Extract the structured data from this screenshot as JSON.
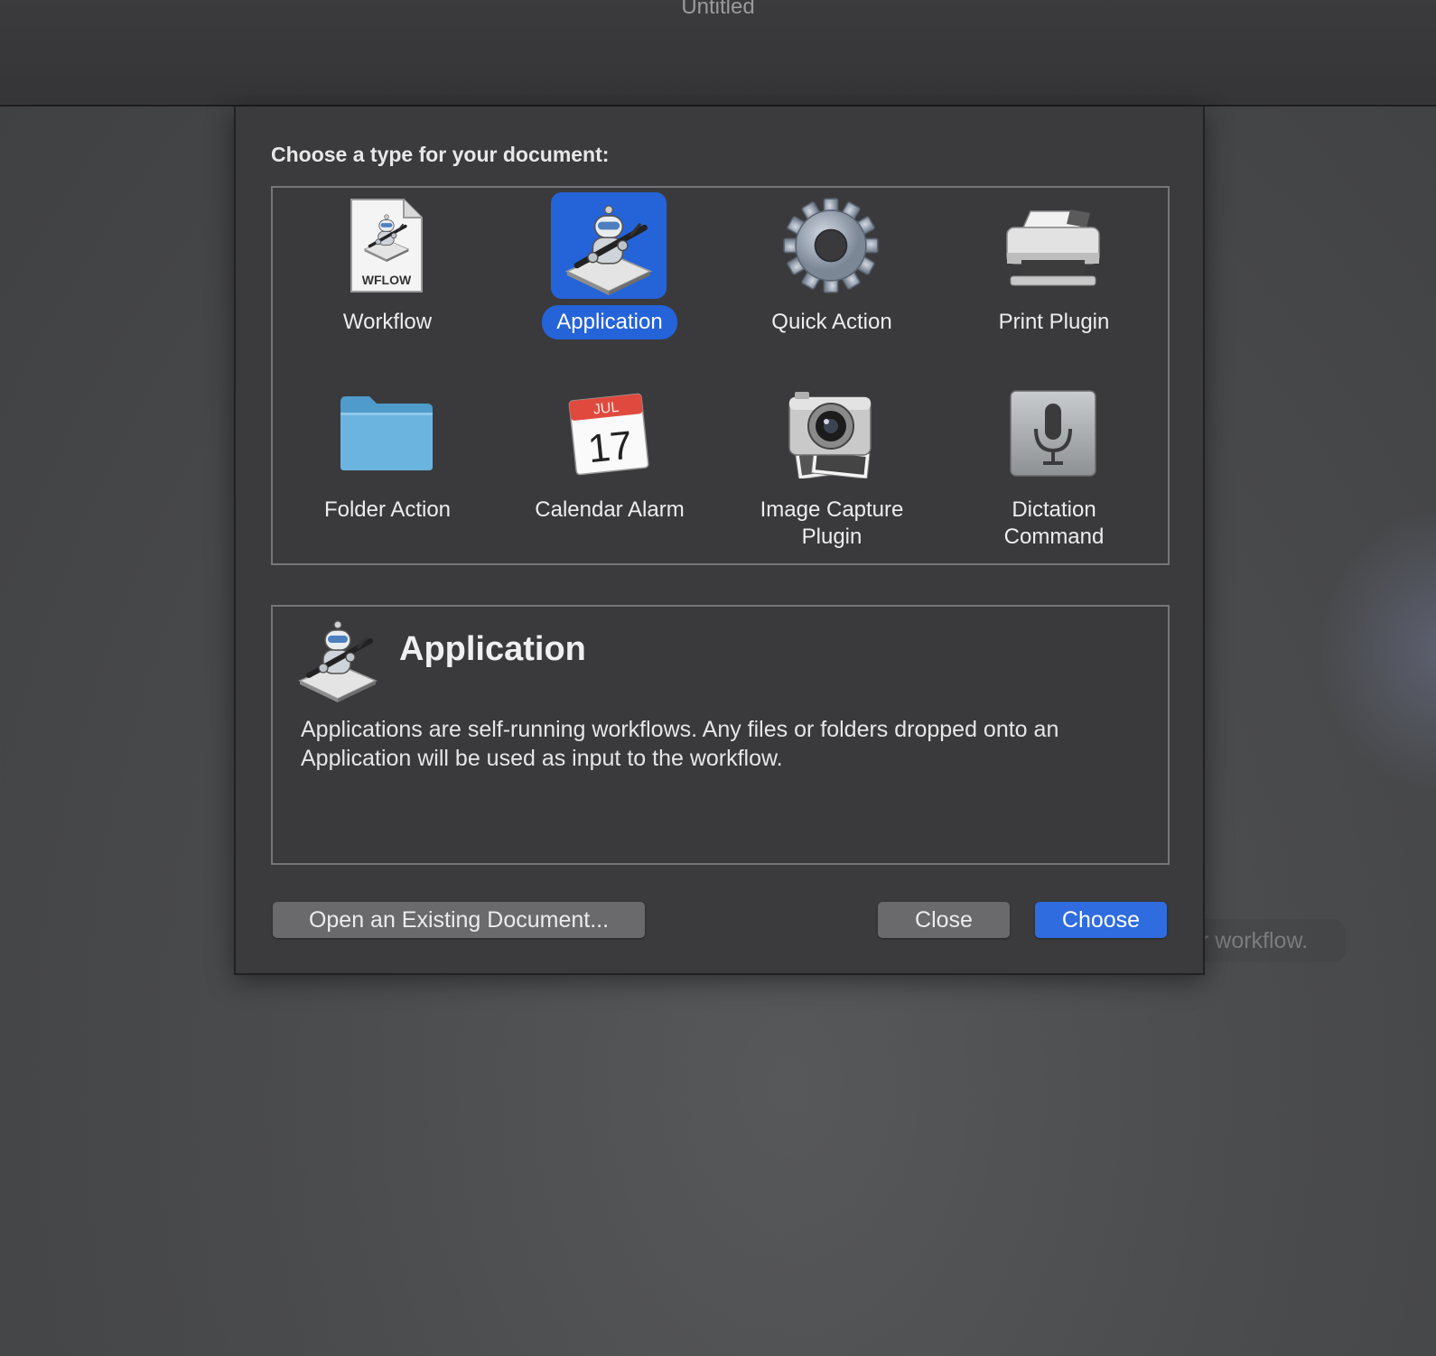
{
  "window": {
    "title": "Untitled"
  },
  "background": {
    "hint_text": "r workflow."
  },
  "dialog": {
    "prompt": "Choose a type for your document:",
    "types": [
      {
        "label": "Workflow",
        "icon": "workflow-file-icon",
        "icon_text": "WFLOW",
        "selected": false
      },
      {
        "label": "Application",
        "icon": "automator-robot-icon",
        "selected": true
      },
      {
        "label": "Quick Action",
        "icon": "gear-icon",
        "selected": false
      },
      {
        "label": "Print Plugin",
        "icon": "printer-icon",
        "selected": false
      },
      {
        "label": "Folder Action",
        "icon": "folder-icon",
        "selected": false
      },
      {
        "label": "Calendar Alarm",
        "icon": "calendar-icon",
        "icon_text": {
          "month": "JUL",
          "day": "17"
        },
        "selected": false
      },
      {
        "label": "Image Capture\nPlugin",
        "icon": "camera-icon",
        "selected": false
      },
      {
        "label": "Dictation\nCommand",
        "icon": "microphone-icon",
        "selected": false
      }
    ],
    "description": {
      "title": "Application",
      "text": "Applications are self-running workflows. Any files or folders dropped onto an Application will be used as input to the workflow."
    },
    "buttons": {
      "open_existing": "Open an Existing Document...",
      "close": "Close",
      "choose": "Choose"
    },
    "colors": {
      "accent": "#2563d9",
      "sheet": "#3b3b3d",
      "border": "#767678"
    }
  }
}
